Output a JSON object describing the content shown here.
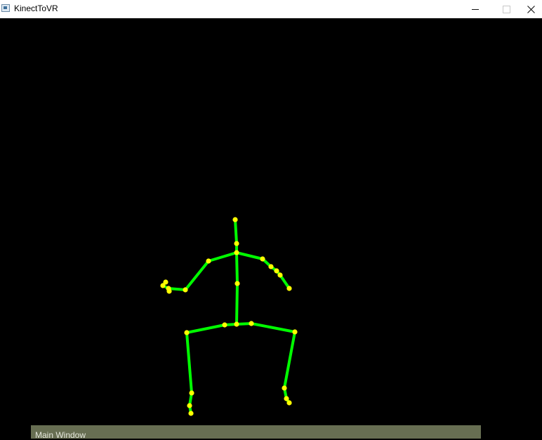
{
  "window": {
    "title": "KinectToVR",
    "icon": "app-window-icon",
    "controls": [
      "minimize-icon",
      "maximize-icon",
      "close-icon"
    ]
  },
  "scene": {
    "background_color": "#000000",
    "bone_color": "#00ff00",
    "joint_color": "#ffff00"
  },
  "panel": {
    "label": "Main Window",
    "background_color": "#676e52"
  }
}
